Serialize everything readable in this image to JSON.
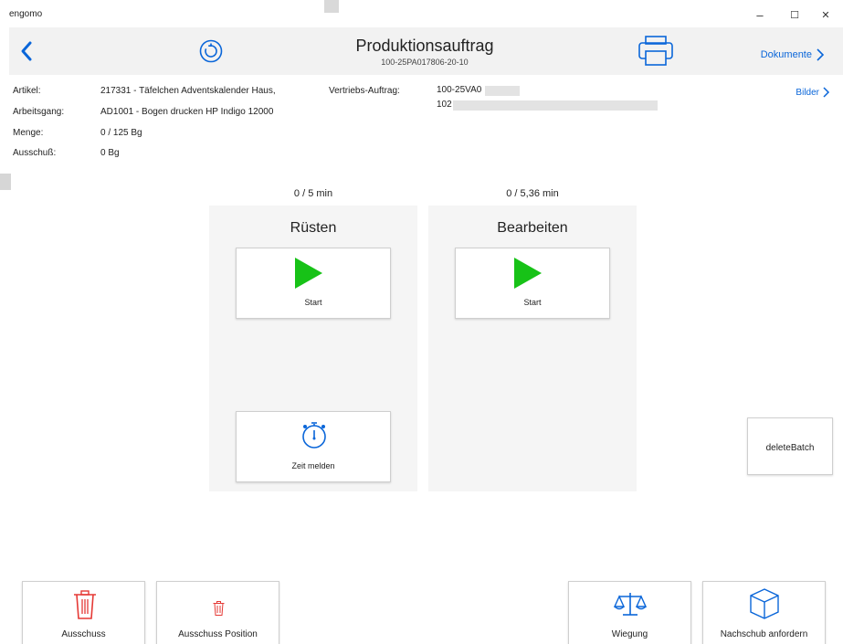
{
  "window": {
    "app_name": "engomo",
    "minimize": "–",
    "maximize": "☐",
    "close": "✕"
  },
  "header": {
    "title": "Produktionsauftrag",
    "subtitle": "100-25PA017806-20-10",
    "documents_label": "Dokumente"
  },
  "info": {
    "artikel_label": "Artikel:",
    "artikel_value": "217331 - Täfelchen Adventskalender Haus,",
    "arbeitsgang_label": "Arbeitsgang:",
    "arbeitsgang_value": "AD1001 - Bogen drucken HP Indigo 12000",
    "menge_label": "Menge:",
    "menge_value": "0 / 125 Bg",
    "ausschuss_label": "Ausschuß:",
    "ausschuss_value": "0 Bg",
    "vertrieb_label": "Vertriebs-Auftrag:",
    "vertrieb_value_1": "100-25VA0",
    "vertrieb_value_2": "102",
    "bilder_label": "Bilder"
  },
  "panels": {
    "ruesten": {
      "time": "0 / 5 min",
      "title": "Rüsten",
      "start_label": "Start",
      "zeit_melden_label": "Zeit melden"
    },
    "bearbeiten": {
      "time": "0 / 5,36 min",
      "title": "Bearbeiten",
      "start_label": "Start"
    }
  },
  "actions": {
    "delete_batch": "deleteBatch",
    "ausschuss": "Ausschuss",
    "ausschuss_position": "Ausschuss Position",
    "wiegung": "Wiegung",
    "nachschub": "Nachschub anfordern"
  },
  "colors": {
    "accent": "#0a66d9",
    "play_green": "#17c217",
    "trash_red": "#e53935",
    "panel_bg": "#f5f5f5",
    "header_bg": "#f2f2f2"
  },
  "icons": {
    "back": "chevron-left-icon",
    "refresh": "refresh-icon",
    "print": "printer-icon",
    "play": "play-icon",
    "stopwatch": "stopwatch-icon",
    "trash": "trash-icon",
    "scale": "scale-icon",
    "box": "box-icon"
  }
}
